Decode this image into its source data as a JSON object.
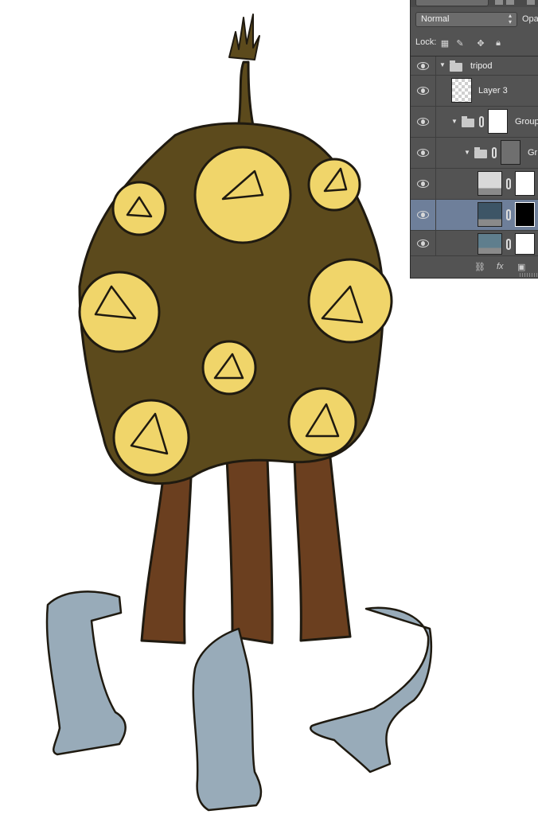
{
  "panel": {
    "blend_mode": "Normal",
    "opacity_label": "Opa",
    "lock_label": "Lock:",
    "icons": [
      "lock-transparent-icon",
      "lock-image-icon",
      "lock-position-icon",
      "lock-all-icon"
    ],
    "layers": [
      {
        "name": "tripod",
        "type": "group",
        "indent": 0
      },
      {
        "name": "Layer 3",
        "type": "layer",
        "indent": 1
      },
      {
        "name": "Group",
        "type": "group-mask",
        "indent": 1
      },
      {
        "name": "Gr",
        "type": "group-mask",
        "indent": 2
      },
      {
        "name": "",
        "type": "adjustment",
        "indent": 3
      },
      {
        "name": "",
        "type": "adjustment",
        "indent": 3,
        "selected": true
      },
      {
        "name": "",
        "type": "adjustment",
        "indent": 3
      }
    ],
    "bottom_icons": [
      "link-icon",
      "fx-icon",
      "mask-icon"
    ],
    "fx_label": "fx"
  },
  "artwork": {
    "subject": "creature-illustration",
    "colors": {
      "body": "#5c4a1c",
      "pod": "#f0d56a",
      "legs": "#6b3f1f",
      "limbs": "#98abb9",
      "outline": "#1f1a10"
    }
  }
}
